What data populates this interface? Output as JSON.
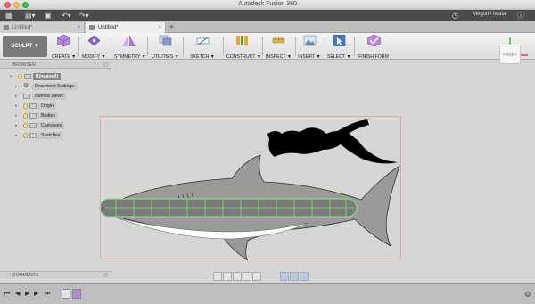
{
  "window": {
    "title": "Autodesk Fusion 360"
  },
  "quick_access": {
    "icons": [
      "app-grid-icon",
      "file-icon",
      "save-icon",
      "undo-icon",
      "redo-icon",
      "clock-icon",
      "help-icon"
    ],
    "user_name": "Megumi Iwata"
  },
  "tabs": [
    {
      "label": "Untitled*"
    },
    {
      "label": "Untitled*"
    }
  ],
  "toolbar": {
    "workspace": "SCULPT ▼",
    "groups": [
      {
        "label": "CREATE ▼",
        "icon": "cube-icon",
        "color": "#b58ad8"
      },
      {
        "label": "MODIFY ▼",
        "icon": "modify-icon",
        "color": "#8a6ac8"
      },
      {
        "label": "SYMMETRY ▼",
        "icon": "symmetry-icon",
        "color": "#9b7ad8"
      },
      {
        "label": "UTILITIES ▼",
        "icon": "utilities-icon",
        "color": "#8898c8"
      },
      {
        "label": "SKETCH ▼",
        "icon": "sketch-icon",
        "color": "#6a8ab8"
      },
      {
        "label": "CONSTRUCT ▼",
        "icon": "construct-icon",
        "color": "#e7a53a"
      },
      {
        "label": "INSPECT ▼",
        "icon": "inspect-icon",
        "color": "#d9b640"
      },
      {
        "label": "INSERT ▼",
        "icon": "insert-icon",
        "color": "#6a8aa8"
      },
      {
        "label": "SELECT ▼",
        "icon": "select-icon",
        "color": "#4a7ab8"
      },
      {
        "label": "FINISH FORM",
        "icon": "finish-form-icon",
        "color": "#b58ad8"
      }
    ]
  },
  "browser": {
    "header": "BROWSER",
    "root": "(Unsaved)",
    "items": [
      {
        "label": "Document Settings",
        "icon": "gear-icon"
      },
      {
        "label": "Named Views",
        "icon": "folder-icon"
      },
      {
        "label": "Origin",
        "icon": "bulb-icon"
      },
      {
        "label": "Bodies",
        "icon": "bulb-icon"
      },
      {
        "label": "Canvases",
        "icon": "bulb-icon"
      },
      {
        "label": "Sketches",
        "icon": "bulb-icon"
      }
    ]
  },
  "viewcube": {
    "label": "FRONT"
  },
  "comments": {
    "label": "COMMENTS"
  },
  "colors": {
    "shark_fill": "#9a9a9a",
    "shark_belly": "#ffffff",
    "diver_fill": "#000000",
    "body_fill": "#7a7a7a",
    "edge_green": "#7de07d",
    "frame_red": "#e8a8a8"
  }
}
